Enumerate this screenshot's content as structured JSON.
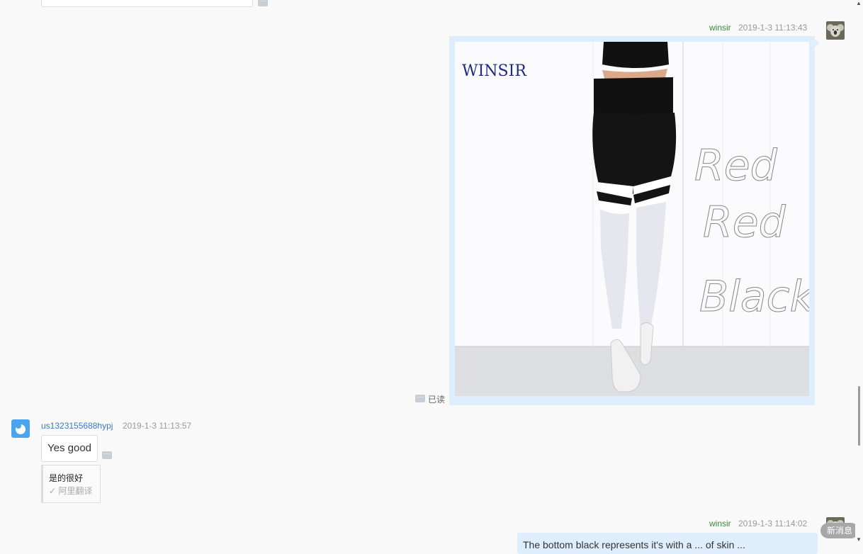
{
  "messages": {
    "m1": {
      "sender": "winsir",
      "time": "2019-1-3 11:13:43",
      "read_status": "已读",
      "image_watermark": "WINSIR",
      "image_handwriting": [
        "Red",
        "Red",
        "Black"
      ]
    },
    "m2": {
      "sender": "us1323155688hypj",
      "time": "2019-1-3 11:13:57",
      "text": "Yes good",
      "translation": "是的很好",
      "translation_source": "阿里翻译"
    },
    "m3": {
      "sender": "winsir",
      "time": "2019-1-3 11:14:02",
      "text": "The bottom black represents it's with a ... of skin ..."
    }
  },
  "more_label": "···",
  "new_message_label": "新消息",
  "colors": {
    "sender_self": "#3c8a3c",
    "sender_other": "#3b79c2",
    "bubble_self": "#dfeefc"
  }
}
